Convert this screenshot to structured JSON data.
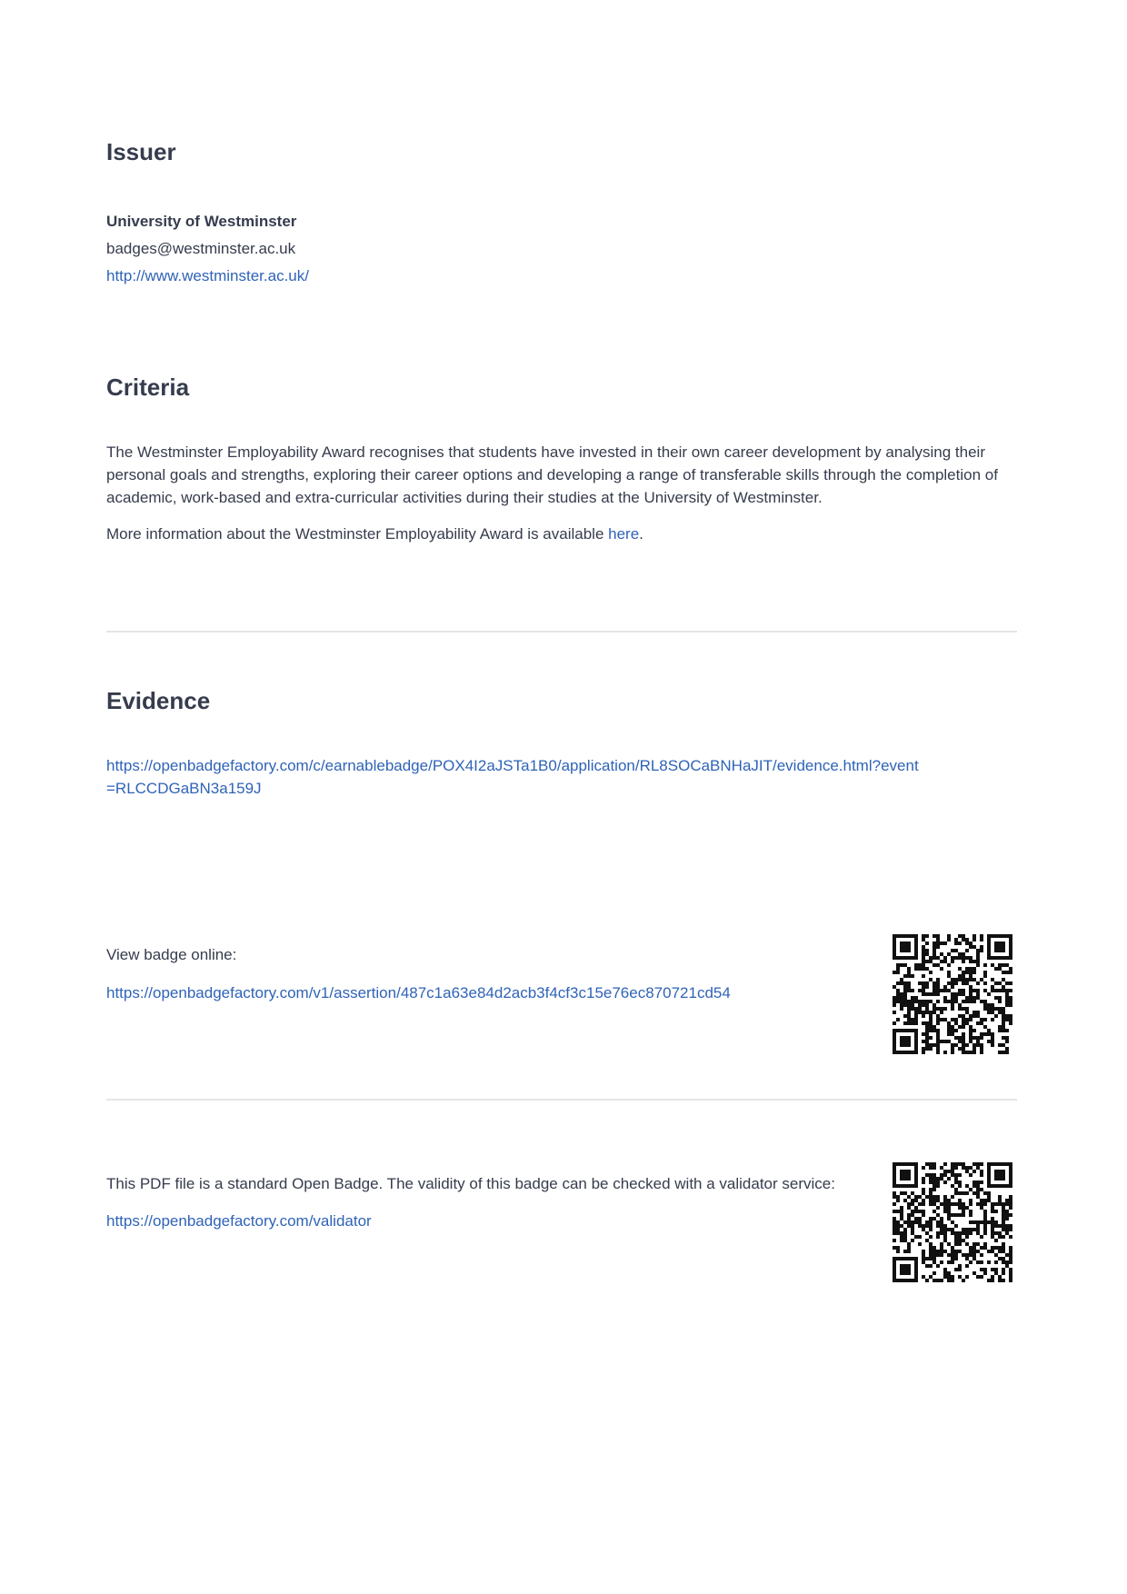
{
  "issuer": {
    "heading": "Issuer",
    "name": "University of Westminster",
    "email": "badges@westminster.ac.uk",
    "url": "http://www.westminster.ac.uk/"
  },
  "criteria": {
    "heading": "Criteria",
    "paragraph": "The Westminster Employability Award recognises that students have invested in their own career development by analysing their personal goals and strengths, exploring their career options and developing a range of transferable skills through the completion of academic, work-based and extra-curricular activities during their studies at the University of Westminster.",
    "more_info_prefix": "More information about the Westminster Employability Award is available ",
    "more_info_link": "here",
    "more_info_suffix": "."
  },
  "evidence": {
    "heading": "Evidence",
    "url": "https://openbadgefactory.com/c/earnablebadge/POX4I2aJSTa1B0/application/RL8SOCaBNHaJIT/evidence.html?event=RLCCDGaBN3a159J"
  },
  "view_online": {
    "label": "View badge online:",
    "url": "https://openbadgefactory.com/v1/assertion/487c1a63e84d2acb3f4cf3c15e76ec870721cd54",
    "qr_icon": "qr-code-icon"
  },
  "validator": {
    "text": "This PDF file is a standard Open Badge. The validity of this badge can be checked with a validator service:",
    "url": "https://openbadgefactory.com/validator",
    "qr_icon": "qr-code-icon"
  },
  "colors": {
    "link": "#2f63b8",
    "text": "#363c4d",
    "rule": "#e3e5e8"
  }
}
